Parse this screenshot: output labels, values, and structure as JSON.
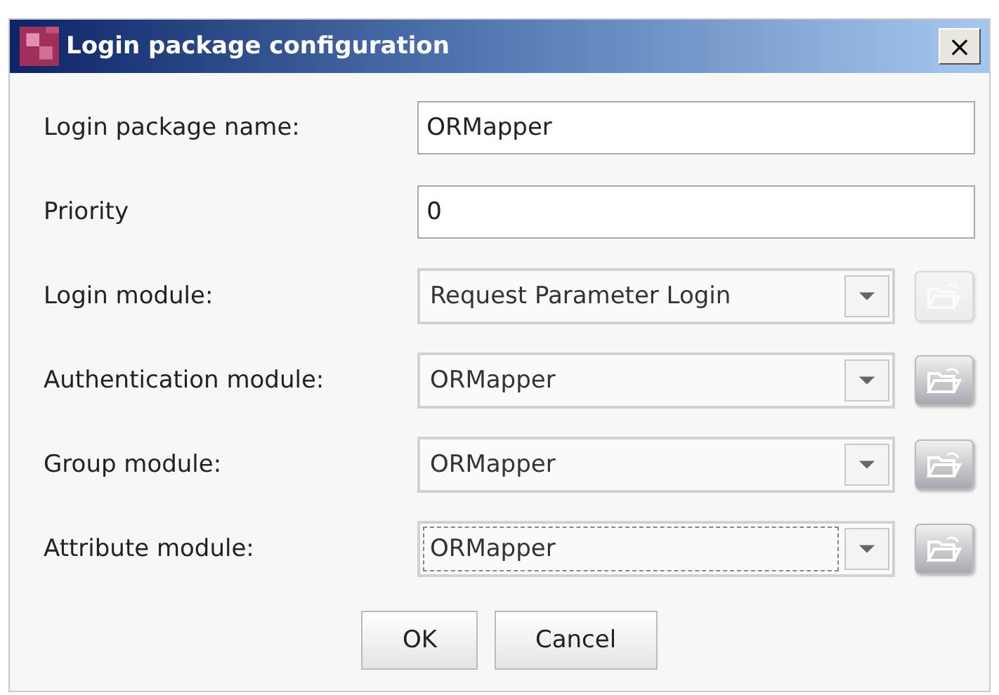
{
  "window": {
    "title": "Login package configuration",
    "close": "×"
  },
  "fields": [
    {
      "kind": "text",
      "label": "Login package name:",
      "value": "ORMapper"
    },
    {
      "kind": "text",
      "label": "Priority",
      "value": "0"
    },
    {
      "kind": "select",
      "label": "Login module:",
      "value": "Request Parameter Login",
      "focused": false,
      "browse_disabled": true
    },
    {
      "kind": "select",
      "label": "Authentication module:",
      "value": "ORMapper",
      "focused": false,
      "browse_disabled": false
    },
    {
      "kind": "select",
      "label": "Group module:",
      "value": "ORMapper",
      "focused": false,
      "browse_disabled": false
    },
    {
      "kind": "select",
      "label": "Attribute module:",
      "value": "ORMapper",
      "focused": true,
      "browse_disabled": false
    }
  ],
  "buttons": [
    "OK",
    "Cancel"
  ]
}
